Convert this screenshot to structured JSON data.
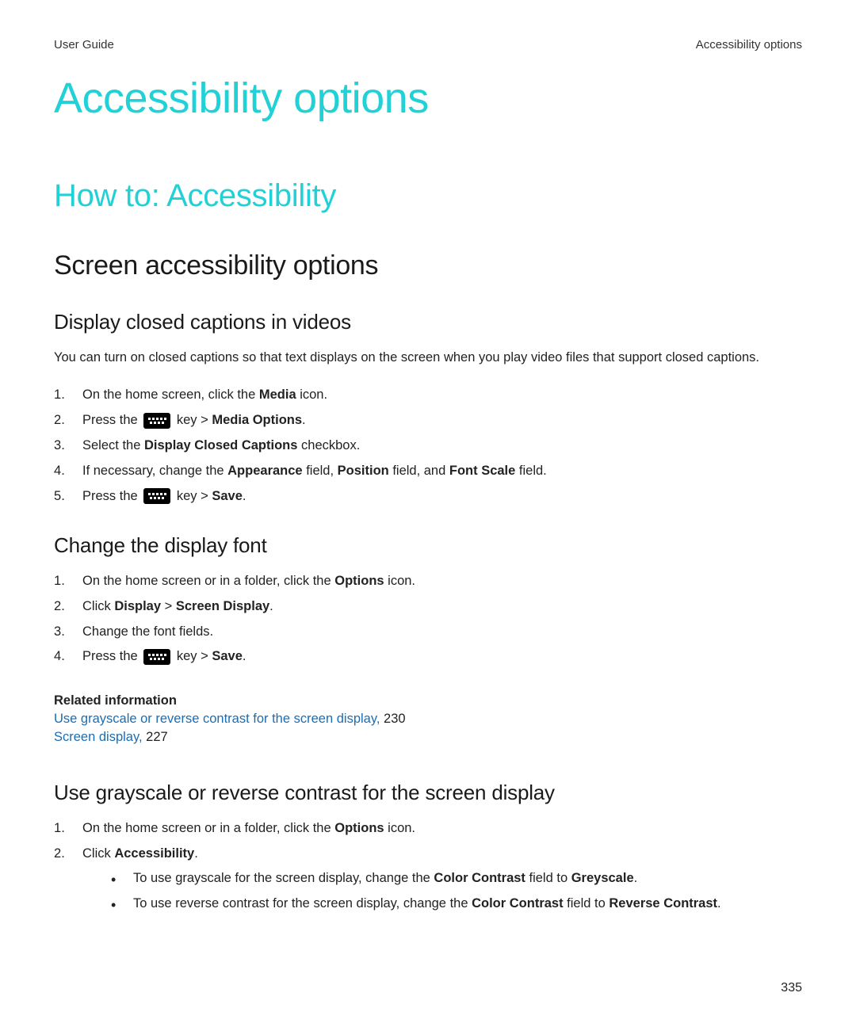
{
  "header": {
    "left": "User Guide",
    "right": "Accessibility options"
  },
  "h1": "Accessibility options",
  "h2": "How to: Accessibility",
  "h3": "Screen accessibility options",
  "section1": {
    "title": "Display closed captions in videos",
    "intro": "You can turn on closed captions so that text displays on the screen when you play video files that support closed captions.",
    "steps": {
      "s1_a": "On the home screen, click the ",
      "s1_b": "Media",
      "s1_c": " icon.",
      "s2_a": "Press the ",
      "s2_b": " key > ",
      "s2_c": "Media Options",
      "s2_d": ".",
      "s3_a": "Select the ",
      "s3_b": "Display Closed Captions",
      "s3_c": " checkbox.",
      "s4_a": "If necessary, change the ",
      "s4_b": "Appearance",
      "s4_c": " field, ",
      "s4_d": "Position",
      "s4_e": " field, and ",
      "s4_f": "Font Scale",
      "s4_g": " field.",
      "s5_a": "Press the ",
      "s5_b": " key > ",
      "s5_c": "Save",
      "s5_d": "."
    }
  },
  "section2": {
    "title": "Change the display font",
    "steps": {
      "s1_a": "On the home screen or in a folder, click the ",
      "s1_b": "Options",
      "s1_c": " icon.",
      "s2_a": "Click ",
      "s2_b": "Display",
      "s2_c": " > ",
      "s2_d": "Screen Display",
      "s2_e": ".",
      "s3": "Change the font fields.",
      "s4_a": "Press the ",
      "s4_b": " key > ",
      "s4_c": "Save",
      "s4_d": "."
    }
  },
  "related": {
    "heading": "Related information",
    "link1": "Use grayscale or reverse contrast for the screen display,",
    "pg1": " 230",
    "link2": "Screen display,",
    "pg2": " 227"
  },
  "section3": {
    "title": "Use grayscale or reverse contrast for the screen display",
    "steps": {
      "s1_a": "On the home screen or in a folder, click the ",
      "s1_b": "Options",
      "s1_c": " icon.",
      "s2_a": "Click ",
      "s2_b": "Accessibility",
      "s2_c": ".",
      "b1_a": "To use grayscale for the screen display, change the ",
      "b1_b": "Color Contrast",
      "b1_c": " field to ",
      "b1_d": "Greyscale",
      "b1_e": ".",
      "b2_a": "To use reverse contrast for the screen display, change the ",
      "b2_b": "Color Contrast",
      "b2_c": " field to ",
      "b2_d": "Reverse Contrast",
      "b2_e": "."
    }
  },
  "page_number": "335"
}
